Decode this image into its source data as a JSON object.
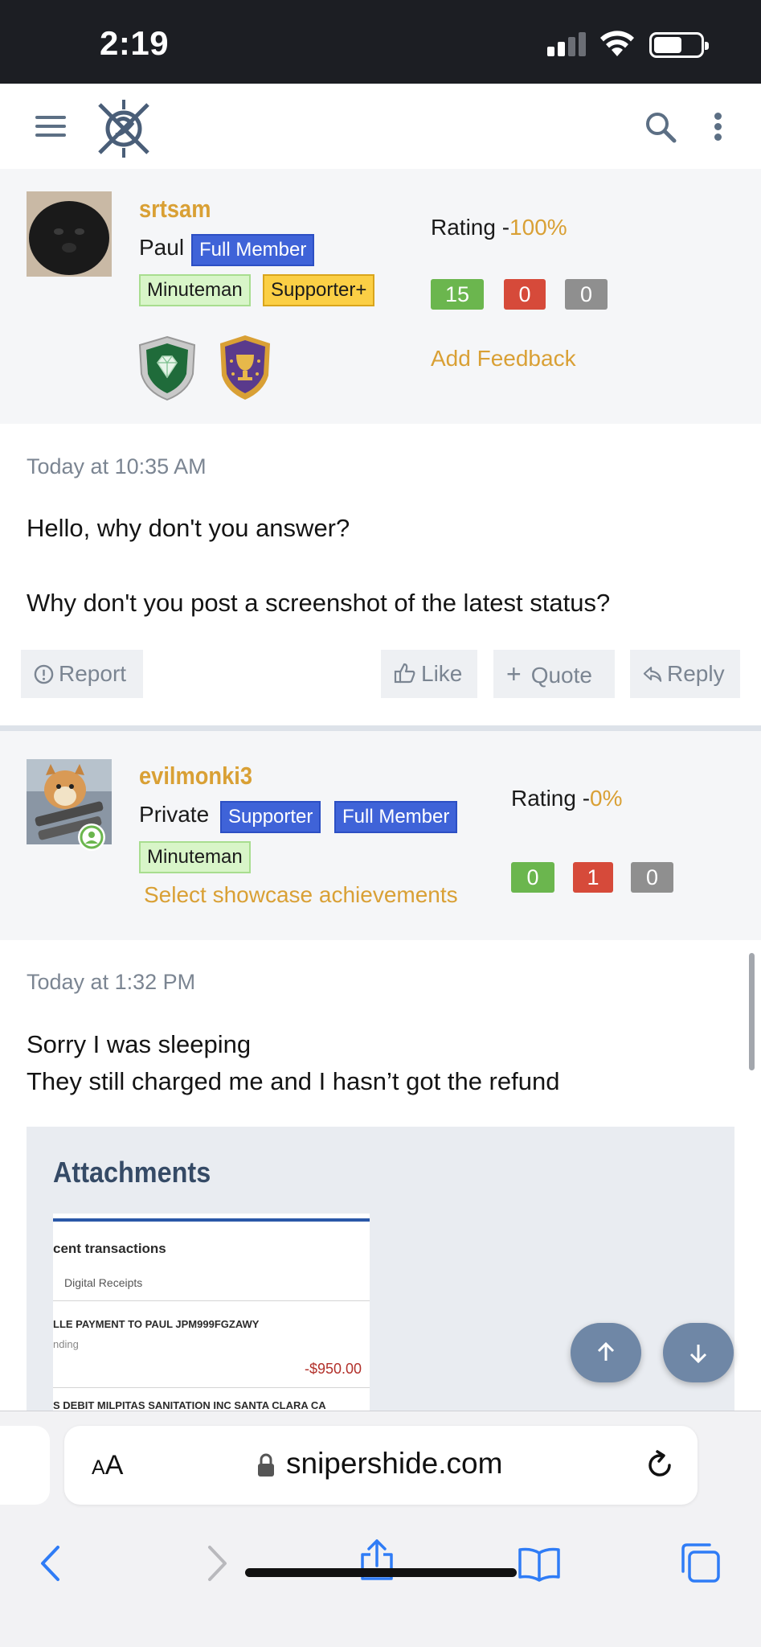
{
  "status_bar": {
    "time": "2:19"
  },
  "site": {
    "domain": "snipershide.com"
  },
  "icons": {
    "menu": "hamburger-menu-icon",
    "logo": "snipershide-logo-icon",
    "search": "search-icon",
    "more": "more-vertical-icon",
    "report": "exclamation-circle-icon",
    "like": "thumbs-up-icon",
    "quote": "plus-icon",
    "reply": "reply-arrow-icon"
  },
  "colors": {
    "username": "#d9a035",
    "badge_blue": "#3f63d8",
    "badge_green": "#d8f5c8",
    "badge_yellow": "#fbcf45",
    "positive": "#6bb64e",
    "negative": "#d64a3a",
    "neutral": "#8f8f8f",
    "scroll_button": "#6f87a6"
  },
  "member1": {
    "username": "srtsam",
    "real_name": "Paul",
    "badges": [
      "Full Member",
      "Minuteman",
      "Supporter+"
    ],
    "rating_prefix": "Rating -",
    "rating_percent": "100%",
    "feedback": {
      "positive": "15",
      "negative": "0",
      "neutral": "0"
    },
    "add_feedback": "Add Feedback",
    "trophies": [
      "diamond-shield-trophy-icon",
      "cup-shield-trophy-icon"
    ]
  },
  "post1": {
    "time": "Today at 10:35 AM",
    "lines": [
      "Hello, why don't you answer?",
      "Why don't you post a screenshot of the latest status?"
    ],
    "actions": {
      "report": "Report",
      "like": "Like",
      "quote": "Quote",
      "reply": "Reply"
    }
  },
  "member2": {
    "username": "evilmonki3",
    "real_name": "Private",
    "badges": [
      "Supporter",
      "Full Member",
      "Minuteman"
    ],
    "rating_prefix": "Rating -",
    "rating_percent": "0%",
    "feedback": {
      "positive": "0",
      "negative": "1",
      "neutral": "0"
    },
    "showcase_link": "Select showcase achievements"
  },
  "post2": {
    "time": "Today at 1:32 PM",
    "lines": [
      "Sorry I was sleeping",
      "They still charged me and I hasn’t got the refund"
    ],
    "attachments_title": "Attachments",
    "attachment_preview": {
      "heading": "cent transactions",
      "receipts": "Digital Receipts",
      "line1": "LLE PAYMENT TO PAUL JPM999FGZAWY",
      "status": "nding",
      "amount": "-$950.00",
      "line2": "S DEBIT MILPITAS SANITATION INC SANTA CLARA CA"
    }
  },
  "browser": {
    "text_size_label_small": "A",
    "text_size_label_large": "A"
  }
}
